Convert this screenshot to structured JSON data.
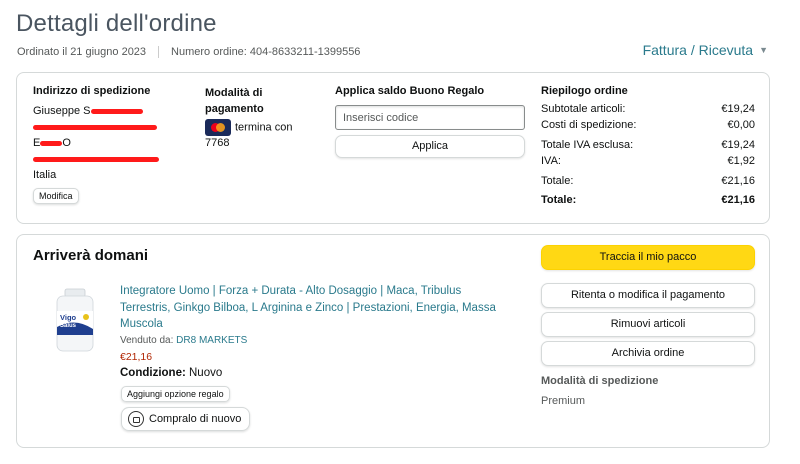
{
  "page": {
    "title": "Dettagli dell'ordine",
    "ordered_on": "Ordinato il 21 giugno 2023",
    "order_number": "Numero ordine: 404-8633211-1399556",
    "invoice_link": "Fattura / Ricevuta"
  },
  "shipping_address": {
    "heading": "Indirizzo di spedizione",
    "name": "Giuseppe S",
    "line2": "",
    "line3": "E",
    "line3_suffix": "O",
    "country": "Italia",
    "edit_button": "Modifica"
  },
  "payment": {
    "heading": "Modalità di pagamento",
    "card_text": "termina con 7768",
    "card_icon": "mastercard-icon"
  },
  "gift_card": {
    "heading": "Applica saldo Buono Regalo",
    "input_placeholder": "Inserisci codice",
    "apply_button": "Applica"
  },
  "summary": {
    "heading": "Riepilogo ordine",
    "rows": [
      {
        "label": "Subtotale articoli:",
        "value": "€19,24"
      },
      {
        "label": "Costi di spedizione:",
        "value": "€0,00"
      },
      {
        "label": "Totale IVA esclusa:",
        "value": "€19,24"
      },
      {
        "label": "IVA:",
        "value": "€1,92"
      },
      {
        "label": "Totale:",
        "value": "€21,16"
      }
    ],
    "grand_total": {
      "label": "Totale:",
      "value": "€21,16"
    }
  },
  "shipment": {
    "status": "Arriverà domani",
    "product_title": "Integratore Uomo | Forza + Durata - Alto Dosaggio | Maca, Tribulus Terrestris, Ginkgo Bilboa, L Arginina e Zinco | Prestazioni, Energia, Massa Muscola",
    "sold_by_label": "Venduto da:",
    "seller": "DR8 MARKETS",
    "price": "€21,16",
    "condition_label": "Condizione:",
    "condition_value": "Nuovo",
    "gift_option_button": "Aggiungi opzione regalo",
    "buy_again_button": "Compralo di nuovo",
    "product_image_text": "Vigo Salus"
  },
  "actions": {
    "track": "Traccia il mio pacco",
    "retry_payment": "Ritenta o modifica il pagamento",
    "remove_items": "Rimuovi articoli",
    "archive": "Archivia ordine",
    "shipping_method_heading": "Modalità di spedizione",
    "shipping_method": "Premium"
  },
  "colors": {
    "link": "#2a7a8c",
    "price": "#b12704",
    "primary_button": "#ffd814",
    "redaction": "#ff1a1a"
  }
}
